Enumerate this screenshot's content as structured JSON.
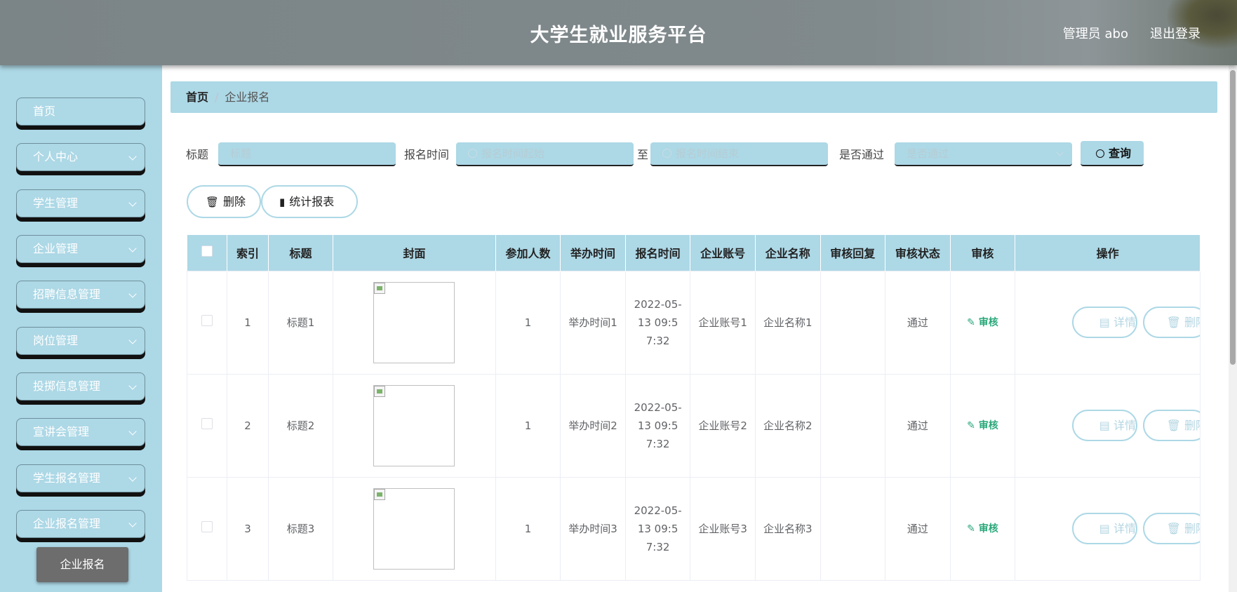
{
  "app": {
    "title": "大学生就业服务平台",
    "user_label": "管理员 abo",
    "logout_label": "退出登录"
  },
  "sidebar": {
    "items": [
      {
        "label": "首页",
        "has_arrow": false
      },
      {
        "label": "个人中心",
        "has_arrow": true
      },
      {
        "label": "学生管理",
        "has_arrow": true
      },
      {
        "label": "企业管理",
        "has_arrow": true
      },
      {
        "label": "招聘信息管理",
        "has_arrow": true
      },
      {
        "label": "岗位管理",
        "has_arrow": true
      },
      {
        "label": "投掷信息管理",
        "has_arrow": true
      },
      {
        "label": "宣讲会管理",
        "has_arrow": true
      },
      {
        "label": "学生报名管理",
        "has_arrow": true
      },
      {
        "label": "企业报名管理",
        "has_arrow": true
      }
    ],
    "active_sub": "企业报名"
  },
  "breadcrumb": {
    "home": "首页",
    "separator": "/",
    "current": "企业报名"
  },
  "search": {
    "title_label": "标题",
    "title_placeholder": "标题",
    "time_label": "报名时间",
    "time_start_placeholder": "报名时间起始",
    "to_label": "至",
    "time_end_placeholder": "报名时间结束",
    "pass_label": "是否通过",
    "pass_placeholder": "是否通过",
    "query_label": "查询"
  },
  "actions": {
    "delete_label": "删除",
    "report_label": "统计报表"
  },
  "table": {
    "headers": [
      "索引",
      "标题",
      "封面",
      "参加人数",
      "举办时间",
      "报名时间",
      "企业账号",
      "企业名称",
      "审核回复",
      "审核状态",
      "审核",
      "操作"
    ],
    "rows": [
      {
        "index": "1",
        "title": "标题1",
        "count": "1",
        "hold_time": "举办时间1",
        "signup_time": "2022-05-13 09:57:32",
        "account": "企业账号1",
        "name": "企业名称1",
        "reply": "",
        "status": "通过",
        "review": "审核",
        "detail": "详情",
        "delete": "删除"
      },
      {
        "index": "2",
        "title": "标题2",
        "count": "1",
        "hold_time": "举办时间2",
        "signup_time": "2022-05-13 09:57:32",
        "account": "企业账号2",
        "name": "企业名称2",
        "reply": "",
        "status": "通过",
        "review": "审核",
        "detail": "详情",
        "delete": "删除"
      },
      {
        "index": "3",
        "title": "标题3",
        "count": "1",
        "hold_time": "举办时间3",
        "signup_time": "2022-05-13 09:57:32",
        "account": "企业账号3",
        "name": "企业名称3",
        "reply": "",
        "status": "通过",
        "review": "审核",
        "detail": "详情",
        "delete": "删除"
      }
    ]
  },
  "colors": {
    "accent": "#add8e6",
    "header": "#80898c",
    "success": "#2aa87a",
    "active_sub": "#6d6d6d"
  }
}
